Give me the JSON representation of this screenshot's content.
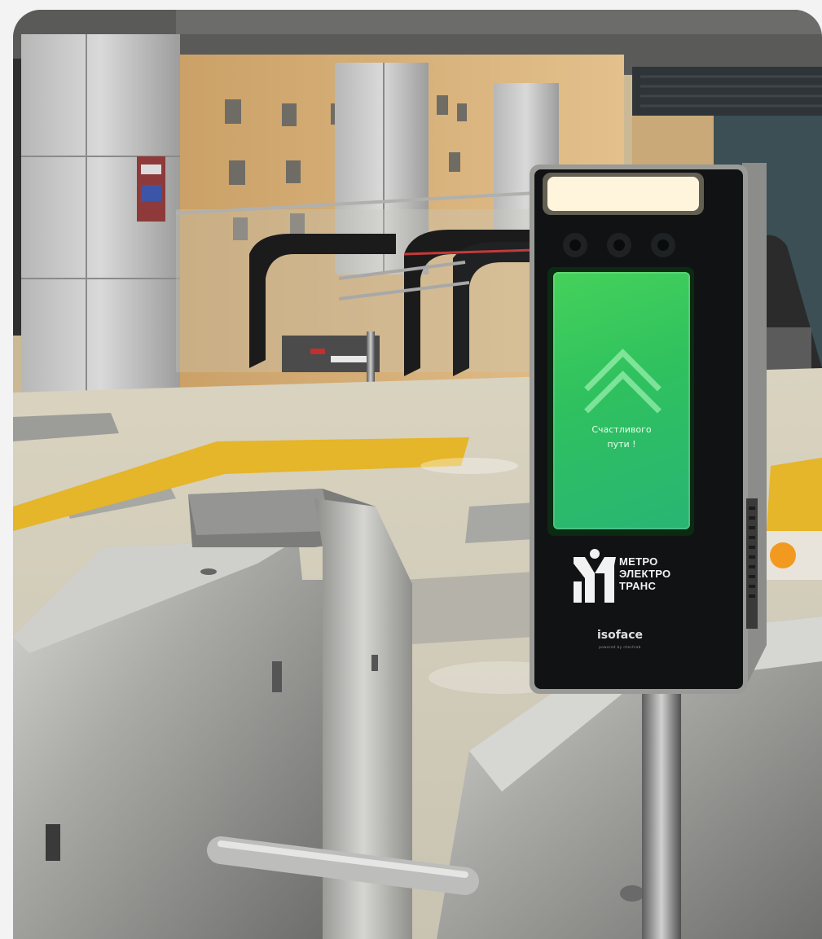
{
  "photo": {
    "description_alt": "",
    "terminal": {
      "screen_line1": "Счастливого",
      "screen_line2": "пути !",
      "logo_line1": "МЕТРО",
      "logo_line2": "ЭЛЕКТРО",
      "logo_line3": "ТРАНС",
      "brand": "isoface",
      "brand_sub": "powered by ntechlab"
    },
    "colors": {
      "screen_green": "#35c45f",
      "tactile_yellow": "#e5b52a",
      "steel": "#9b9b98",
      "terminal_body": "#111214"
    }
  }
}
